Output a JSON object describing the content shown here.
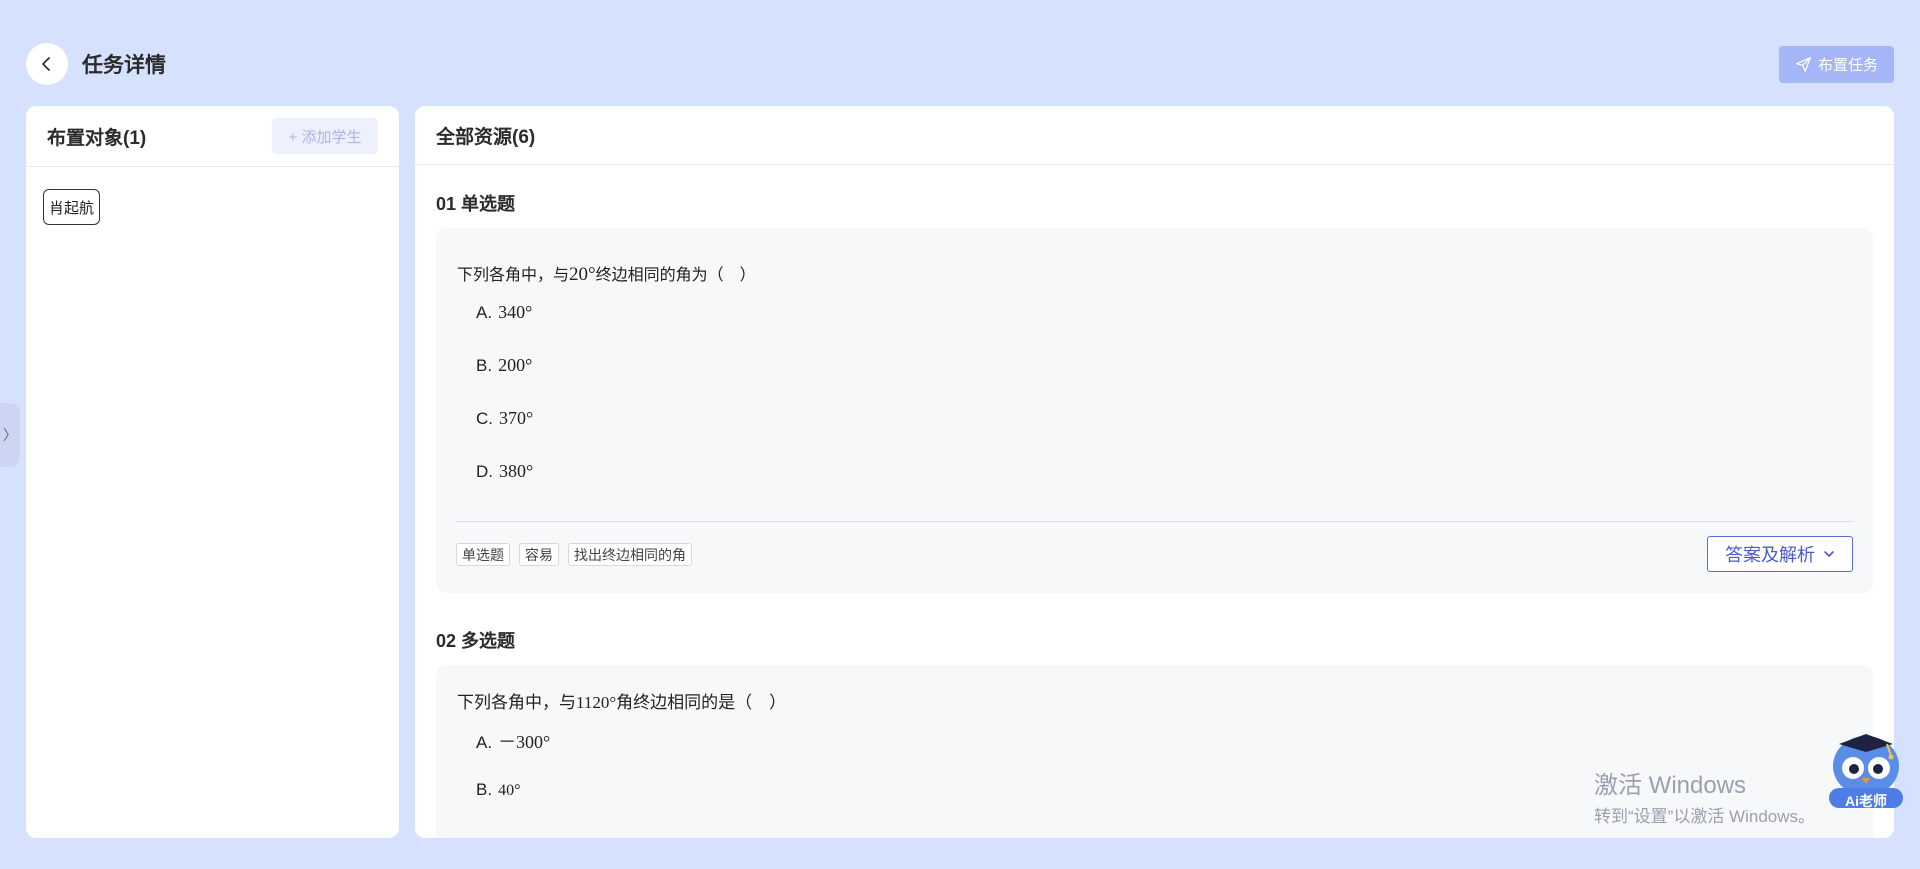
{
  "header": {
    "back_icon": "chevron-left-icon",
    "title": "任务详情",
    "assign_label": "布置任务",
    "assign_icon": "send-icon"
  },
  "left_panel": {
    "title": "布置对象(1)",
    "add_student_label": "+ 添加学生",
    "students": [
      "肖起航"
    ]
  },
  "side_toggle": {
    "label": "〉"
  },
  "right_panel": {
    "title": "全部资源(6)",
    "questions": [
      {
        "section": "01 单选题",
        "stem_prefix": "下列各角中，与",
        "stem_value": "20°",
        "stem_suffix": "终边相同的角为（　）",
        "options": [
          {
            "letter": "A.",
            "value": "340°"
          },
          {
            "letter": "B.",
            "value": "200°"
          },
          {
            "letter": "C.",
            "value": "370°"
          },
          {
            "letter": "D.",
            "value": "380°"
          }
        ],
        "tags": [
          "单选题",
          "容易",
          "找出终边相同的角"
        ],
        "answer_label": "答案及解析"
      },
      {
        "section": "02 多选题",
        "stem": "下列各角中，与1120°角终边相同的是（　）",
        "options": [
          {
            "letter": "A.",
            "value": "－300°"
          },
          {
            "letter": "B.",
            "value": "40°"
          }
        ]
      }
    ]
  },
  "watermark": {
    "line1": "激活 Windows",
    "line2": "转到“设置”以激活 Windows。"
  },
  "ai_assistant": {
    "label": "Ai老师"
  },
  "colors": {
    "background": "#d6e1fd",
    "primary": "#a5b6f8",
    "accent": "#4a5ad0"
  }
}
